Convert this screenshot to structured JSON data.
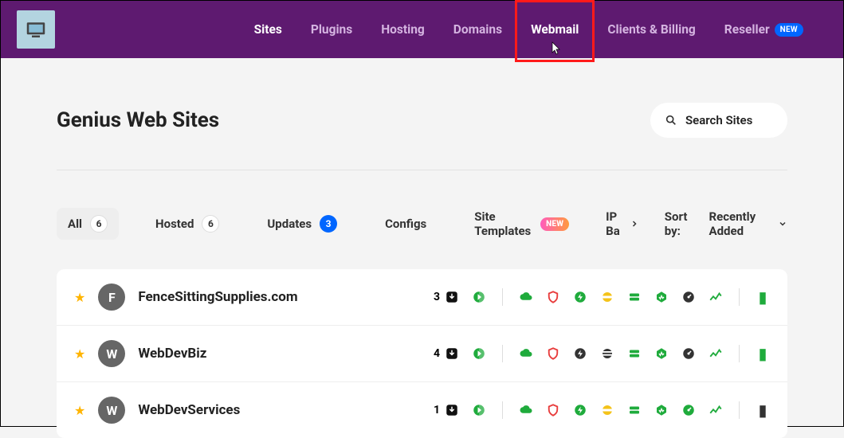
{
  "nav": {
    "items": [
      {
        "label": "Sites",
        "active": true
      },
      {
        "label": "Plugins"
      },
      {
        "label": "Hosting"
      },
      {
        "label": "Domains"
      },
      {
        "label": "Webmail",
        "highlighted": true
      },
      {
        "label": "Clients & Billing"
      },
      {
        "label": "Reseller",
        "badge": "NEW"
      }
    ]
  },
  "page": {
    "title": "Genius Web Sites",
    "search_placeholder": "Search Sites"
  },
  "filters": {
    "all": {
      "label": "All",
      "count": "6"
    },
    "hosted": {
      "label": "Hosted",
      "count": "6"
    },
    "updates": {
      "label": "Updates",
      "count": "3"
    },
    "configs": {
      "label": "Configs"
    },
    "templates": {
      "label": "Site Templates",
      "badge": "NEW"
    },
    "ipba": {
      "label": "IP Ba"
    },
    "sort_label": "Sort by:",
    "sort_value": "Recently Added"
  },
  "sites": [
    {
      "letter": "F",
      "name": "FenceSittingSupplies.com",
      "count": "3",
      "icons": [
        "dl",
        "paper",
        "div",
        "cloud",
        "shield-red",
        "bolt",
        "disc-yellow",
        "bars",
        "heart",
        "gauge",
        "chart",
        "div",
        "book-green"
      ]
    },
    {
      "letter": "W",
      "name": "WebDevBiz",
      "count": "4",
      "icons": [
        "dl",
        "paper",
        "div",
        "cloud",
        "shield-red",
        "bolt-dark",
        "disc-dark",
        "bars",
        "heart",
        "gauge",
        "chart",
        "div",
        "book-green"
      ]
    },
    {
      "letter": "W",
      "name": "WebDevServices",
      "count": "1",
      "icons": [
        "dl",
        "paper",
        "div",
        "cloud",
        "shield-red",
        "bolt",
        "disc-yellow",
        "bars",
        "heart",
        "gauge-green",
        "chart",
        "div",
        "book-dark"
      ]
    }
  ]
}
